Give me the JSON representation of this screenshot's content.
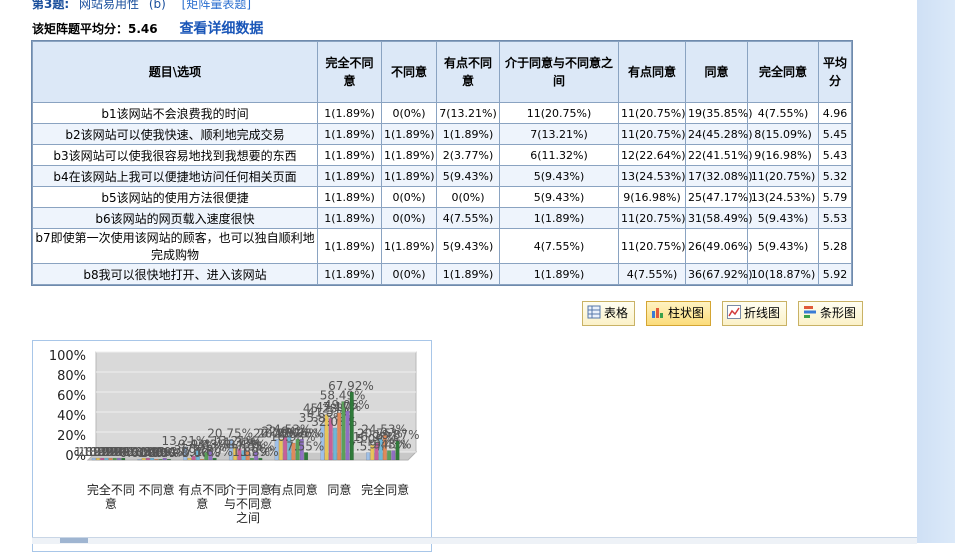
{
  "question": {
    "number": "第3题:",
    "name": "网站易用性",
    "suffix": "(b)",
    "type": "[矩阵量表题]"
  },
  "matrix_avg_text": "该矩阵题平均分：5.46",
  "detail_link": "查看详细数据",
  "table": {
    "headers": [
      "题目\\选项",
      "完全不同意",
      "不同意",
      "有点不同意",
      "介于同意与不同意之间",
      "有点同意",
      "同意",
      "完全同意",
      "平均分"
    ],
    "rows": [
      {
        "label": "b1该网站不会浪费我的时间",
        "cells": [
          "1(1.89%)",
          "0(0%)",
          "7(13.21%)",
          "11(20.75%)",
          "11(20.75%)",
          "19(35.85%)",
          "4(7.55%)",
          "4.96"
        ]
      },
      {
        "label": "b2该网站可以使我快速、顺利地完成交易",
        "cells": [
          "1(1.89%)",
          "1(1.89%)",
          "1(1.89%)",
          "7(13.21%)",
          "11(20.75%)",
          "24(45.28%)",
          "8(15.09%)",
          "5.45"
        ]
      },
      {
        "label": "b3该网站可以使我很容易地找到我想要的东西",
        "cells": [
          "1(1.89%)",
          "1(1.89%)",
          "2(3.77%)",
          "6(11.32%)",
          "12(22.64%)",
          "22(41.51%)",
          "9(16.98%)",
          "5.43"
        ]
      },
      {
        "label": "b4在该网站上我可以便捷地访问任何相关页面",
        "cells": [
          "1(1.89%)",
          "1(1.89%)",
          "5(9.43%)",
          "5(9.43%)",
          "13(24.53%)",
          "17(32.08%)",
          "11(20.75%)",
          "5.32"
        ]
      },
      {
        "label": "b5该网站的使用方法很便捷",
        "cells": [
          "1(1.89%)",
          "0(0%)",
          "0(0%)",
          "5(9.43%)",
          "9(16.98%)",
          "25(47.17%)",
          "13(24.53%)",
          "5.79"
        ]
      },
      {
        "label": "b6该网站的网页载入速度很快",
        "cells": [
          "1(1.89%)",
          "0(0%)",
          "4(7.55%)",
          "1(1.89%)",
          "11(20.75%)",
          "31(58.49%)",
          "5(9.43%)",
          "5.53"
        ]
      },
      {
        "label": "b7即使第一次使用该网站的顾客，也可以独自顺利地完成购物",
        "cells": [
          "1(1.89%)",
          "1(1.89%)",
          "5(9.43%)",
          "4(7.55%)",
          "11(20.75%)",
          "26(49.06%)",
          "5(9.43%)",
          "5.28"
        ]
      },
      {
        "label": "b8我可以很快地打开、进入该网站",
        "cells": [
          "1(1.89%)",
          "0(0%)",
          "1(1.89%)",
          "1(1.89%)",
          "4(7.55%)",
          "36(67.92%)",
          "10(18.87%)",
          "5.92"
        ]
      }
    ]
  },
  "view_buttons": {
    "table": "表格",
    "bar": "柱状图",
    "line": "折线图",
    "strip": "条形图"
  },
  "colors": {
    "header_bg": "#dce8f7",
    "link": "#1a56b8",
    "border": "#8aa3c1"
  },
  "chart_data": {
    "type": "bar",
    "categories": [
      "完全不同意",
      "不同意",
      "有点不同意",
      "介于同意与不同意之间",
      "有点同意",
      "同意",
      "完全同意"
    ],
    "y_ticks": [
      "100%",
      "80%",
      "60%",
      "40%",
      "20%",
      "0%"
    ],
    "ylim": [
      0,
      100
    ],
    "series": [
      {
        "name": "b1",
        "values": [
          1.89,
          0,
          13.21,
          20.75,
          20.75,
          35.85,
          7.55
        ]
      },
      {
        "name": "b2",
        "values": [
          1.89,
          1.89,
          1.89,
          13.21,
          20.75,
          45.28,
          15.09
        ]
      },
      {
        "name": "b3",
        "values": [
          1.89,
          1.89,
          3.77,
          11.32,
          22.64,
          41.51,
          16.98
        ]
      },
      {
        "name": "b4",
        "values": [
          1.89,
          1.89,
          9.43,
          9.43,
          24.53,
          32.08,
          20.75
        ]
      },
      {
        "name": "b5",
        "values": [
          1.89,
          0,
          0,
          9.43,
          16.98,
          47.17,
          24.53
        ]
      },
      {
        "name": "b6",
        "values": [
          1.89,
          0,
          7.55,
          1.89,
          20.75,
          58.49,
          9.43
        ]
      },
      {
        "name": "b7",
        "values": [
          1.89,
          1.89,
          9.43,
          7.55,
          20.75,
          49.06,
          9.43
        ]
      },
      {
        "name": "b8",
        "values": [
          1.89,
          0,
          1.89,
          1.89,
          7.55,
          67.92,
          18.87
        ]
      }
    ],
    "series_colors": [
      "#9ec0e8",
      "#e8c45a",
      "#c75f9a",
      "#6fb7d8",
      "#e08a5a",
      "#5aa05a",
      "#8f6fc4",
      "#2f7a3a"
    ],
    "data_labels": true,
    "grid": true,
    "legend": "none"
  }
}
